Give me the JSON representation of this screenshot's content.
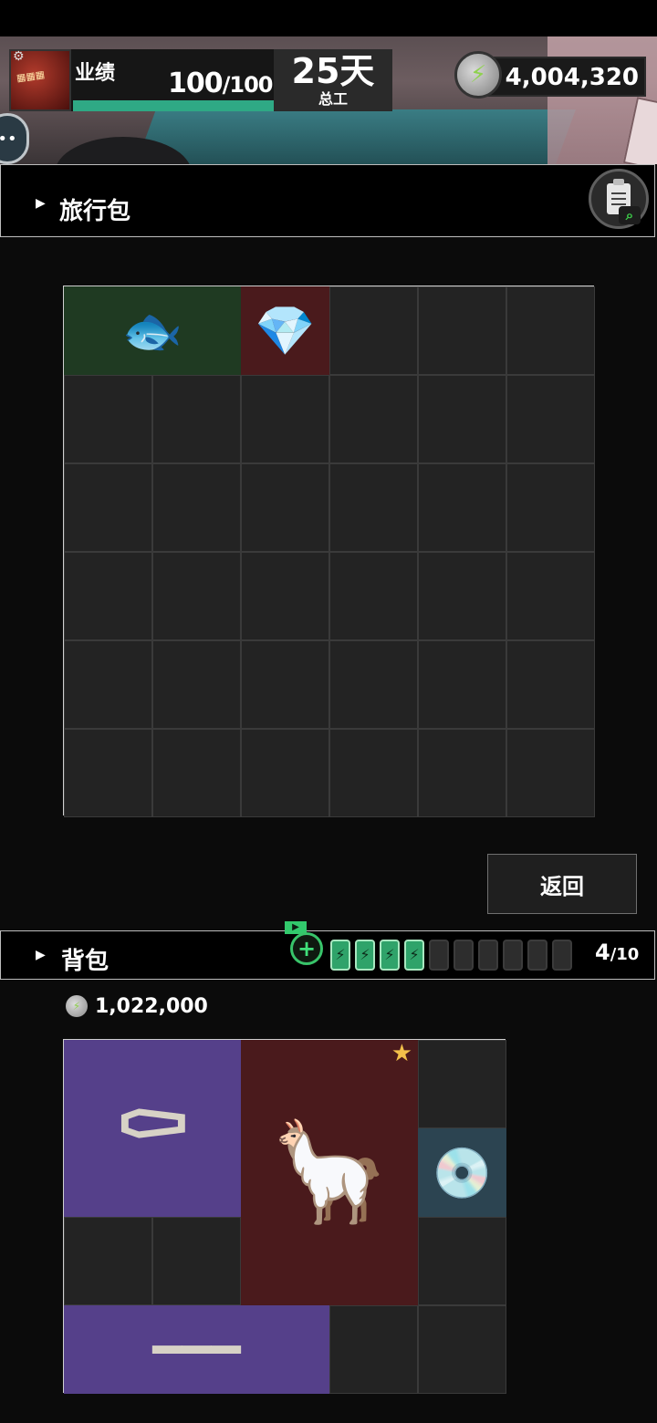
{
  "hud": {
    "company_logo_icon": "company-logo",
    "performance_label": "业绩",
    "performance_current": "100",
    "performance_max": "/100",
    "performance_progress": 1.0,
    "days_value": "25天",
    "days_label": "总工",
    "money_value": "4,004,320",
    "energy_icon": "lightning-coin"
  },
  "travel_bag": {
    "title": "旅行包",
    "clipboard_icon": "clipboard-search",
    "grid": {
      "cols": 6,
      "rows": 6
    },
    "items": [
      {
        "name": "dark-creature-mask",
        "color_class": "green",
        "col": 0,
        "row": 0,
        "w": 2,
        "h": 1,
        "glyph": "🐟"
      },
      {
        "name": "rainbow-crystal",
        "color_class": "red",
        "col": 2,
        "row": 0,
        "w": 1,
        "h": 1,
        "glyph": "💎"
      }
    ],
    "back_button": "返回"
  },
  "backpack": {
    "title": "背包",
    "ad_label": "▶",
    "capacity_current": "4",
    "capacity_max": "/10",
    "batteries_full": 4,
    "batteries_total": 10,
    "money_value": "1,022,000",
    "grid": {
      "cols": 5,
      "rows": 4
    },
    "items": [
      {
        "name": "coffin-dance-item",
        "color_class": "purple",
        "col": 0,
        "row": 0,
        "w": 2,
        "h": 2,
        "glyph": "⚰"
      },
      {
        "name": "alpaca-statue",
        "color_class": "red",
        "col": 2,
        "row": 0,
        "w": 2,
        "h": 3,
        "glyph": "🦙"
      },
      {
        "name": "cd-disc",
        "color_class": "blue",
        "col": 4,
        "row": 1,
        "w": 1,
        "h": 1,
        "glyph": "💿"
      },
      {
        "name": "golden-staff",
        "color_class": "purple",
        "col": 0,
        "row": 3,
        "w": 3,
        "h": 1,
        "glyph": "━━━"
      }
    ],
    "star_icon": "★"
  },
  "colors": {
    "green": "#1f3a22",
    "red": "#4a1a1c",
    "purple": "#55408a",
    "blue": "#2c4451",
    "accent_green": "#2fa985"
  }
}
